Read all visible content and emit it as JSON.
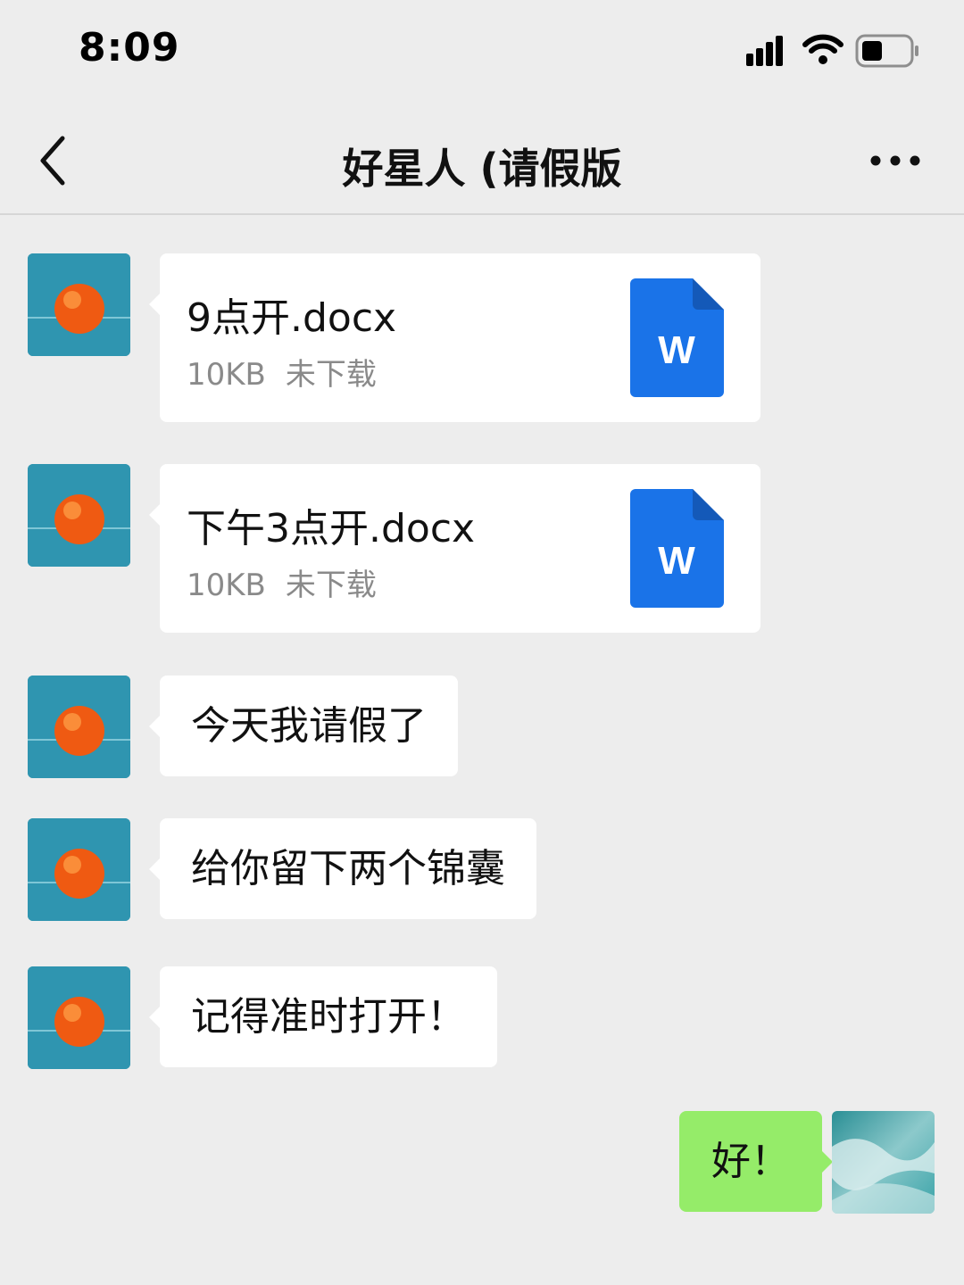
{
  "status_bar": {
    "time": "8:09"
  },
  "header": {
    "title": "好星人 (请假版",
    "back_icon": "chevron-left-icon",
    "more_icon": "more-dots-icon"
  },
  "messages": [
    {
      "type": "file",
      "sender": "other",
      "file_name": "9点开.docx",
      "size": "10KB",
      "status": "未下载",
      "icon": "word-file-icon",
      "icon_letter": "W"
    },
    {
      "type": "file",
      "sender": "other",
      "file_name": "下午3点开.docx",
      "size": "10KB",
      "status": "未下载",
      "icon": "word-file-icon",
      "icon_letter": "W"
    },
    {
      "type": "text",
      "sender": "other",
      "text": "今天我请假了"
    },
    {
      "type": "text",
      "sender": "other",
      "text": "给你留下两个锦囊"
    },
    {
      "type": "text",
      "sender": "other",
      "text": "记得准时打开！"
    },
    {
      "type": "text",
      "sender": "self",
      "text": "好！"
    }
  ],
  "colors": {
    "background": "#ededed",
    "self_bubble": "#95ec69",
    "other_bubble": "#ffffff",
    "word_blue": "#1a73e8"
  }
}
